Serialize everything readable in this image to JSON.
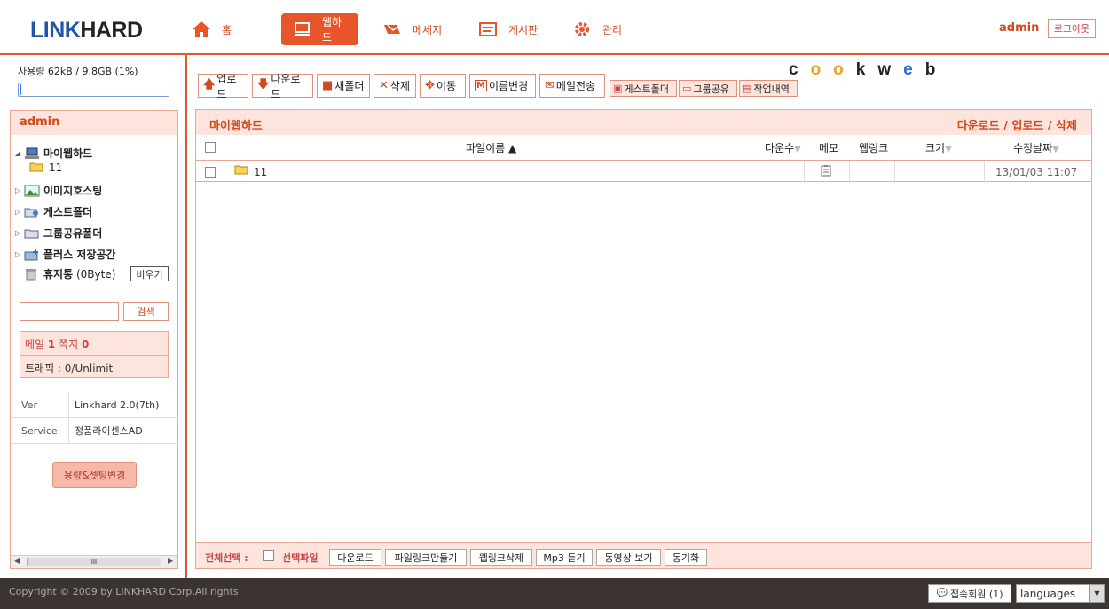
{
  "header": {
    "logo_a": "LINK",
    "logo_b": "HARD",
    "nav": [
      {
        "label": "홈",
        "icon": "home-icon"
      },
      {
        "label": "웹하드",
        "icon": "monitor-icon"
      },
      {
        "label": "메세지",
        "icon": "message-icon"
      },
      {
        "label": "게시판",
        "icon": "board-icon"
      },
      {
        "label": "관리",
        "icon": "gear-icon"
      }
    ],
    "user": "admin",
    "logout": "로그아웃"
  },
  "sidebar": {
    "usage": "사용량 62kB / 9,8GB (1%)",
    "usage_fraction": 0.01,
    "panel_title": "admin",
    "tree": [
      {
        "label": "마이웹하드",
        "icon": "computer-icon",
        "expanded": true
      },
      {
        "label": "11",
        "icon": "folder-icon"
      },
      {
        "label": "이미지호스팅",
        "icon": "image-icon"
      },
      {
        "label": "게스트폴더",
        "icon": "guest-folder-icon"
      },
      {
        "label": "그룹공유폴더",
        "icon": "group-folder-icon"
      },
      {
        "label": "플러스 저장공간",
        "icon": "plus-storage-icon"
      },
      {
        "label": "휴지통",
        "extra": "(0Byte)",
        "icon": "trash-icon"
      }
    ],
    "empty_btn": "비우기",
    "search_btn": "검색",
    "mail_label": "메일",
    "mail_count": "1",
    "note_label": "쪽지",
    "note_count": "0",
    "traffic": "트래픽 : 0/Unlimit",
    "info": [
      {
        "k": "Ver",
        "v": "Linkhard 2.0(7th)"
      },
      {
        "k": "Service",
        "v": "정품라이센스AD"
      }
    ],
    "setting_btn": "용량&셋팅변경",
    "scroll_thumb": "III"
  },
  "toolbar": {
    "buttons": [
      {
        "label": "업로드",
        "glyph": "🡅"
      },
      {
        "label": "다운로드",
        "glyph": "🡇"
      },
      {
        "label": "새폴더",
        "glyph": "■"
      },
      {
        "label": "삭제",
        "glyph": "✕"
      },
      {
        "label": "이동",
        "glyph": "✥"
      },
      {
        "label": "이름변경",
        "glyph": "M"
      },
      {
        "label": "메일전송",
        "glyph": "✉"
      }
    ],
    "small": [
      "게스트폴더",
      "그룹공유",
      "작업내역"
    ],
    "cookweb": [
      "c",
      "oo",
      "k",
      "w",
      "e",
      "b"
    ]
  },
  "main": {
    "title": "마이웹하드",
    "links": "다운로드 / 업로드 / 삭제",
    "cols": {
      "name": "파일이름 ▲",
      "down": "다운수",
      "memo": "메모",
      "weblink": "웹링크",
      "size": "크기",
      "date": "수정날짜"
    },
    "rows": [
      {
        "name": "11",
        "date": "13/01/03 11:07"
      }
    ],
    "foot": {
      "select_all": "전체선택 :",
      "selected": "선택파일",
      "buttons": [
        "다운로드",
        "파일링크만들기",
        "웹링크삭제",
        "Mp3 듣기",
        "동영상 보기",
        "동기화"
      ]
    }
  },
  "footer": {
    "copy": "Copyright © 2009 by LINKHARD Corp.All rights",
    "online": "접속회원 (1)",
    "lang": "languages"
  }
}
